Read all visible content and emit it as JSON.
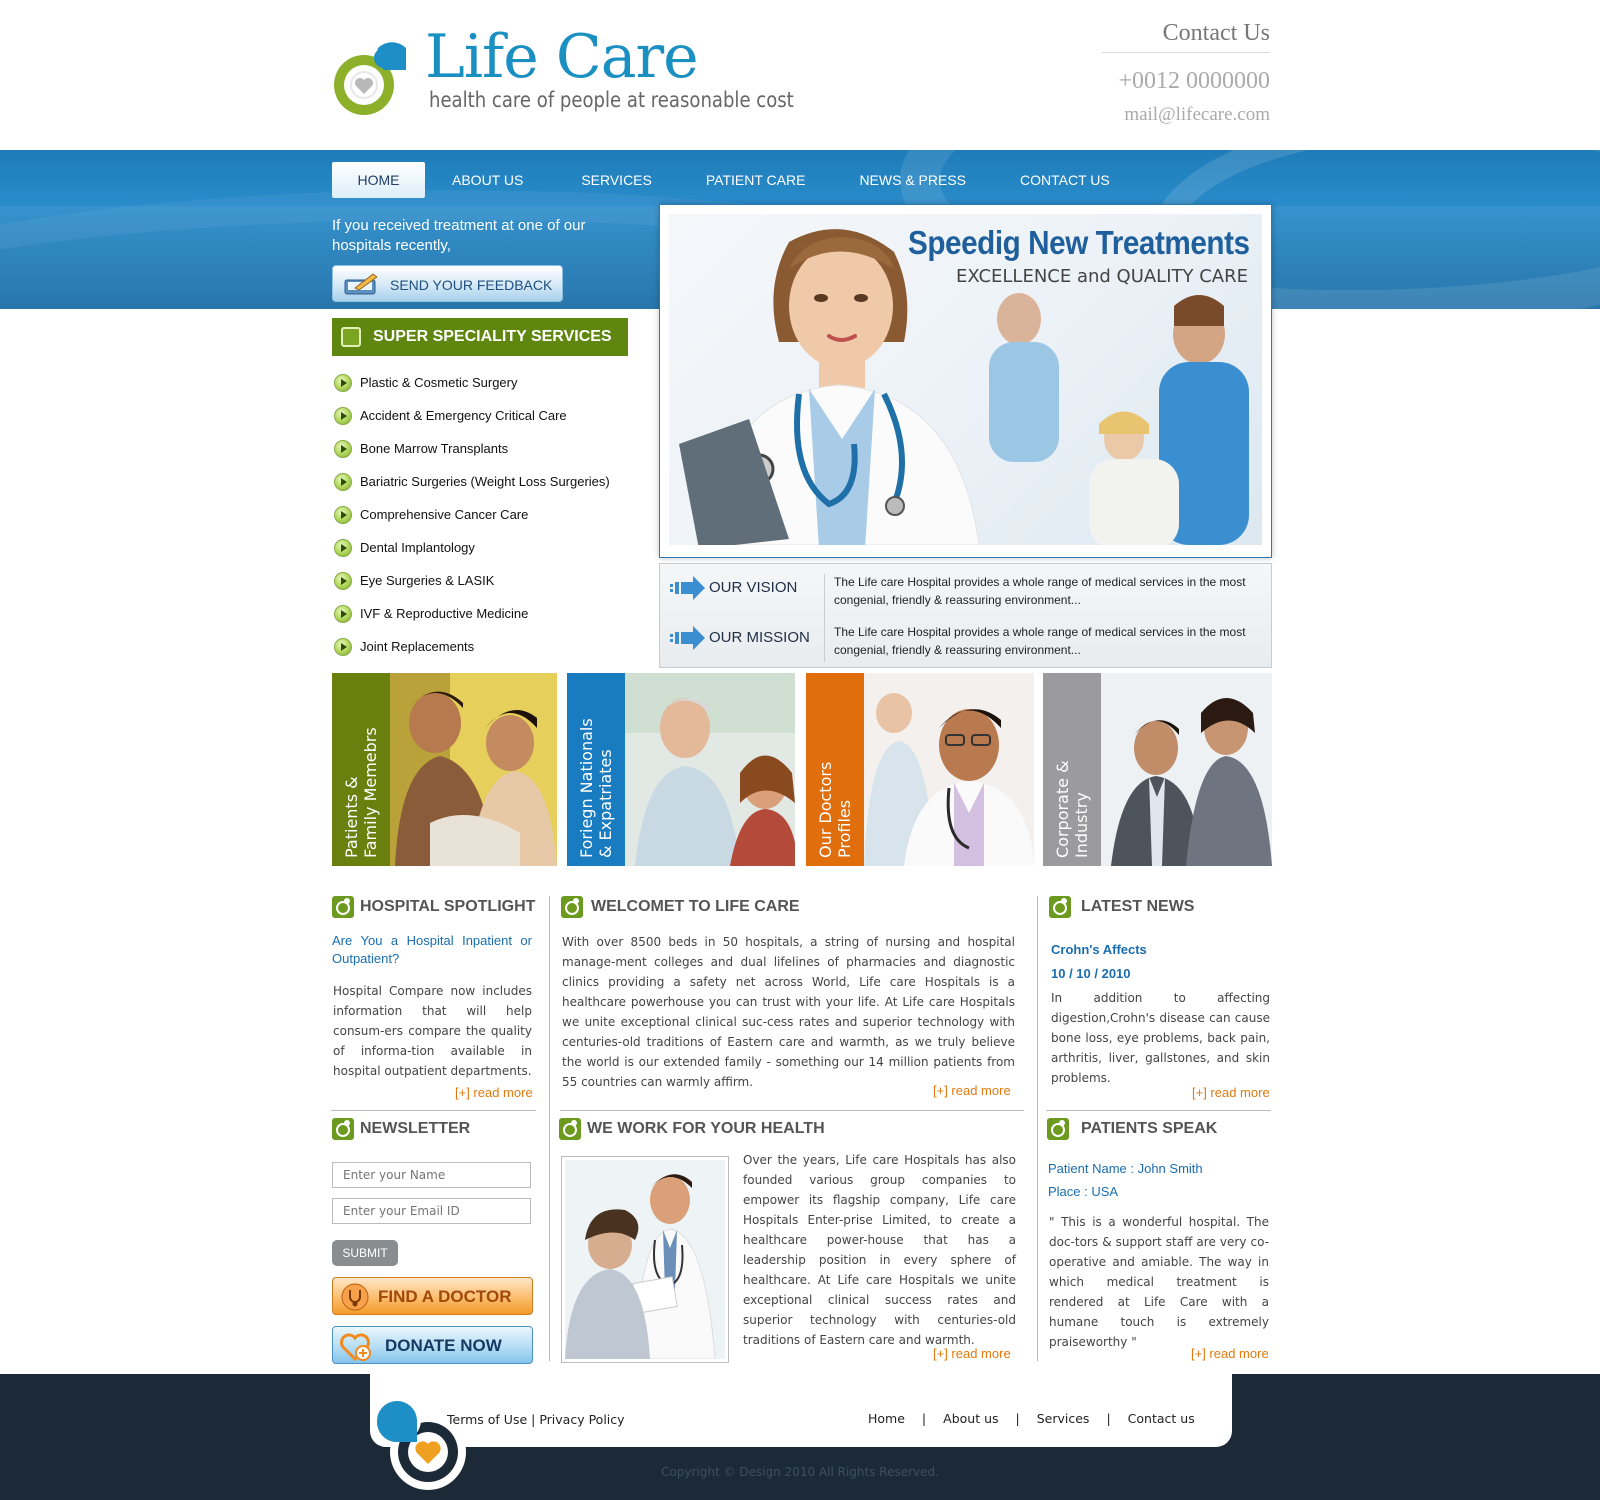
{
  "header": {
    "title": "Life Care",
    "tagline": "health care of people at reasonable cost",
    "contact_title": "Contact Us",
    "phone": "+0012 0000000",
    "email": "mail@lifecare.com"
  },
  "nav": {
    "items": [
      {
        "label": "HOME",
        "active": true
      },
      {
        "label": "ABOUT US"
      },
      {
        "label": "SERVICES"
      },
      {
        "label": "PATIENT CARE"
      },
      {
        "label": "NEWS & PRESS"
      },
      {
        "label": "CONTACT US"
      }
    ]
  },
  "feedback": {
    "text": "If you received treatment at one of our hospitals recently,",
    "button": "SEND YOUR FEEDBACK"
  },
  "hero": {
    "title": "Speedig New Treatments",
    "subtitle": "EXCELLENCE and QUALITY CARE"
  },
  "vision": {
    "label": "OUR VISION",
    "text": "The Life care Hospital provides a whole range of medical services in the most congenial, friendly & reassuring environment..."
  },
  "mission": {
    "label": "OUR MISSION",
    "text": "The Life care Hospital provides a whole range of medical services in the most congenial, friendly & reassuring environment..."
  },
  "specialities": {
    "title": "SUPER SPECIALITY SERVICES",
    "items": [
      "Plastic & Cosmetic Surgery",
      "Accident & Emergency Critical Care",
      "Bone Marrow Transplants",
      "Bariatric Surgeries (Weight Loss Surgeries)",
      "Comprehensive Cancer Care",
      "Dental Implantology",
      "Eye Surgeries & LASIK",
      "IVF & Reproductive Medicine",
      "Joint Replacements"
    ]
  },
  "tiles": [
    {
      "line1": "Patients &",
      "line2": "Family Memebrs",
      "color": "#6b7f0f"
    },
    {
      "line1": "Foriegn  Nationals",
      "line2": "& Expatriates",
      "color": "#1a7cc0"
    },
    {
      "line1": "Our Doctors",
      "line2": "Profiles",
      "color": "#e06e0c"
    },
    {
      "line1": "Corporate &",
      "line2": "Industry",
      "color": "#9b9b9f"
    }
  ],
  "spotlight": {
    "title": "HOSPITAL SPOTLIGHT",
    "question": "Are You a Hospital Inpatient or Outpatient?",
    "text": "Hospital Compare now includes information that will help consum-ers compare the quality of informa-tion available in hospital outpatient departments.",
    "read_more": "[+] read more"
  },
  "welcome": {
    "title": "WELCOMET TO LIFE CARE",
    "text": "With over 8500 beds in 50 hospitals, a string of nursing and hospital manage-ment colleges and dual lifelines of pharmacies and diagnostic clinics providing a safety net across World, Life care Hospitals is a healthcare powerhouse you can trust with your life. At Life care Hospitals we unite exceptional clinical suc-cess rates and superior technology with centuries-old traditions of Eastern care and warmth, as we truly believe the world is our extended family - something our 14 million patients from 55 countries can warmly affirm.",
    "read_more": "[+] read more"
  },
  "news": {
    "title": "LATEST NEWS",
    "headline": "Crohn's Affects",
    "date": "10 / 10 / 2010",
    "text": "In addition to affecting digestion,Crohn's disease can cause bone loss, eye problems, back pain, arthritis, liver, gallstones, and skin problems.",
    "read_more": "[+] read more"
  },
  "newsletter": {
    "title": "NEWSLETTER",
    "name_placeholder": "Enter your Name",
    "email_placeholder": "Enter your Email ID",
    "submit": "SUBMIT"
  },
  "buttons": {
    "find_doctor": "FIND A DOCTOR",
    "donate": "DONATE NOW"
  },
  "health": {
    "title": "WE WORK FOR YOUR HEALTH",
    "text": "Over the years, Life care Hospitals has also founded various group companies to empower its flagship company, Life care Hospitals Enter-prise Limited, to create a healthcare power-house that has a leadership position in every sphere of healthcare. At Life care Hospitals we unite exceptional clinical success rates and superior technology with centuries-old traditions of Eastern care and warmth.",
    "read_more": "[+] read more"
  },
  "patients_speak": {
    "title": "PATIENTS SPEAK",
    "name": "Patient Name : John Smith",
    "place": "Place : USA",
    "quote": "\" This is a wonderful hospital. The doc-tors & support staff are very co-operative and amiable. The way in which medical treatment is rendered at Life Care with a humane touch is extremely praiseworthy \"",
    "read_more": "[+] read more"
  },
  "footer": {
    "terms": "Terms of Use",
    "privacy": "Privacy Policy",
    "links": [
      "Home",
      "About us",
      "Services",
      "Contact us"
    ],
    "copyright": "Copyright © Design 2010 All Rights Reserved."
  },
  "colors": {
    "brand_blue": "#1a8fc2",
    "brand_green": "#5f8710",
    "accent_orange": "#e07a10",
    "footer_bg": "#1c2a38"
  }
}
